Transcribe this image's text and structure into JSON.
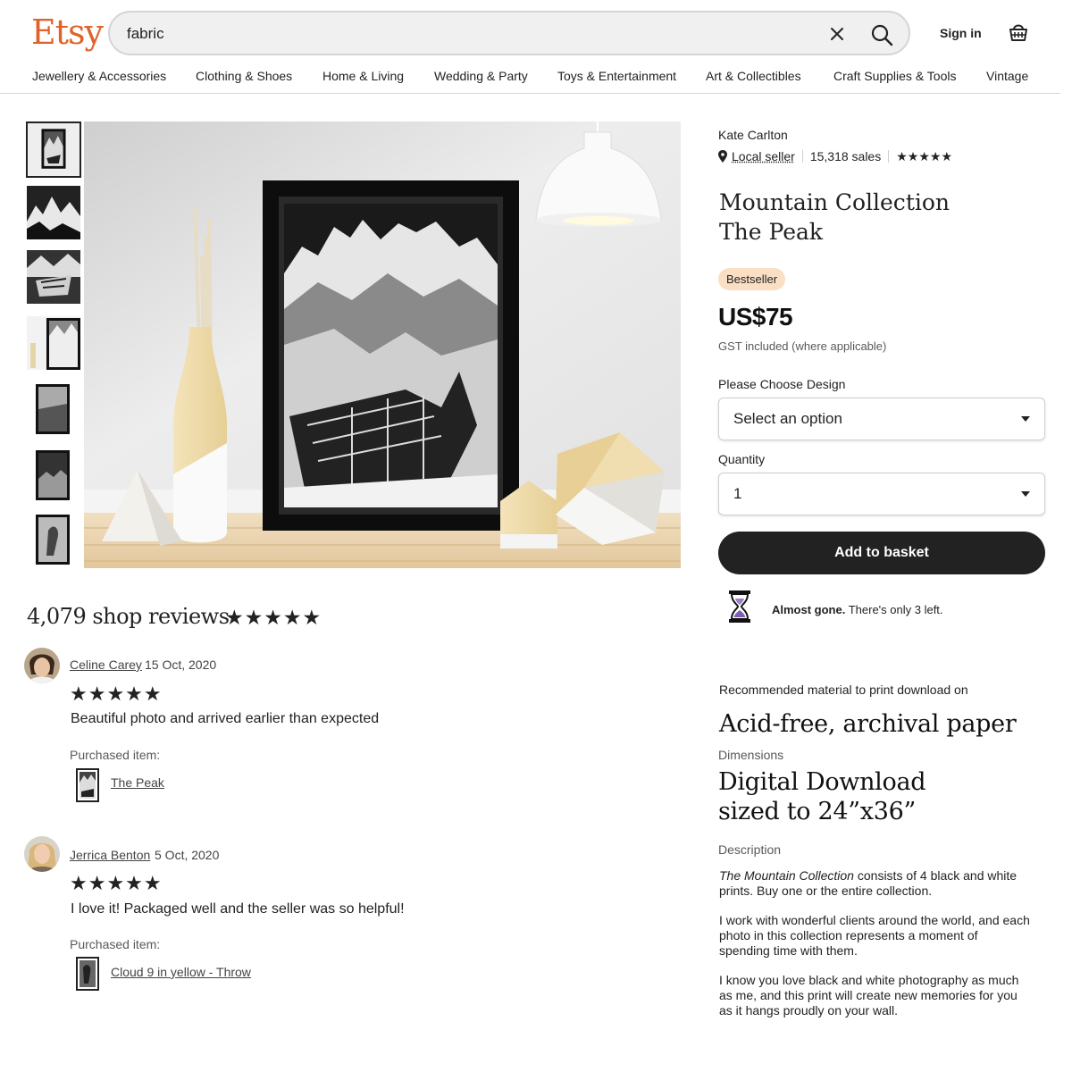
{
  "header": {
    "logo": "Etsy",
    "search_value": "fabric",
    "sign_in": "Sign in",
    "brand_color": "#e0622a"
  },
  "categories": [
    "Jewellery & Accessories",
    "Clothing & Shoes",
    "Home & Living",
    "Wedding & Party",
    "Toys & Entertainment",
    "Art & Collectibles",
    "Craft Supplies & Tools",
    "Vintage"
  ],
  "gallery": {
    "thumbnail_count": 7,
    "selected_index": 0
  },
  "reviews": {
    "heading": "4,079 shop reviews",
    "heading_stars": "★★★★★",
    "items": [
      {
        "name": "Celine Carey",
        "date": "15 Oct, 2020",
        "stars": "★★★★★",
        "text": "Beautiful photo and arrived earlier than expected",
        "purchased_label": "Purchased item:",
        "item_title": "The Peak"
      },
      {
        "name": "Jerrica Benton",
        "date": "5 Oct, 2020",
        "stars": "★★★★★",
        "text": "I love it! Packaged well and the seller was so helpful!",
        "purchased_label": "Purchased item:",
        "item_title": "Cloud 9 in yellow - Throw"
      }
    ]
  },
  "product": {
    "shop_name": "Kate Carlton",
    "local_seller": "Local seller",
    "sales": "15,318 sales",
    "shop_stars": "★★★★★",
    "title_line1": "Mountain Collection",
    "title_line2": "The Peak",
    "badge": "Bestseller",
    "badge_color": "#fadfc4",
    "price": "US$75",
    "gst": "GST included (where applicable)",
    "design_label": "Please Choose Design",
    "design_value": "Select an option",
    "quantity_label": "Quantity",
    "quantity_value": "1",
    "add_to_basket": "Add to basket",
    "stock_bold": "Almost gone.",
    "stock_rest": " There's only 3 left."
  },
  "details": {
    "material_label": "Recommended material to print download on",
    "material_value": "Acid-free, archival paper",
    "dimensions_label": "Dimensions",
    "dimensions_line1": "Digital Download",
    "dimensions_line2": "sized to 24”x36”",
    "description_label": "Description",
    "description_p1_italic": "The Mountain Collection",
    "description_p1_rest": " consists of 4 black and white prints. Buy one or the entire collection.",
    "description_p2": "I work with wonderful clients around the world, and each photo in this collection represents a moment of spending time with them.",
    "description_p3": "I know you love black and white photography as much as me, and this print will create new memories for you as it hangs proudly on your wall."
  }
}
